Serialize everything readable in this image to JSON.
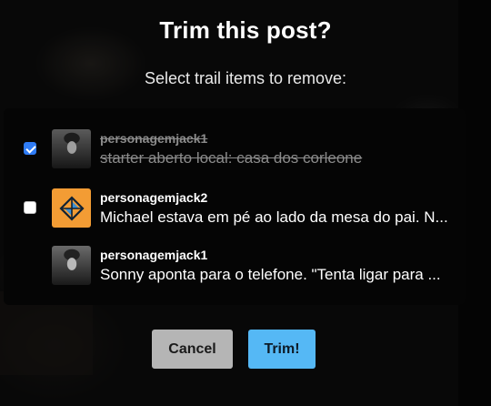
{
  "dialog": {
    "title": "Trim this post?",
    "subtitle": "Select trail items to remove:"
  },
  "trail": [
    {
      "username": "personagemjack1",
      "text": "starter aberto local: casa dos corleone",
      "checked": true,
      "avatar": "photo-avatar"
    },
    {
      "username": "personagemjack2",
      "text": "Michael estava em pé ao lado da mesa do pai. N...",
      "checked": false,
      "avatar": "tumblr-default-avatar"
    },
    {
      "username": "personagemjack1",
      "text": "Sonny aponta para o telefone. \"Tenta ligar para ...",
      "checked": null,
      "avatar": "photo-avatar"
    }
  ],
  "buttons": {
    "cancel": "Cancel",
    "trim": "Trim!"
  },
  "colors": {
    "checkbox_checked": "#2f7cf6",
    "trim_button": "#55b8f5",
    "cancel_button": "#b5b5b5",
    "orange_avatar": "#f39c34"
  }
}
